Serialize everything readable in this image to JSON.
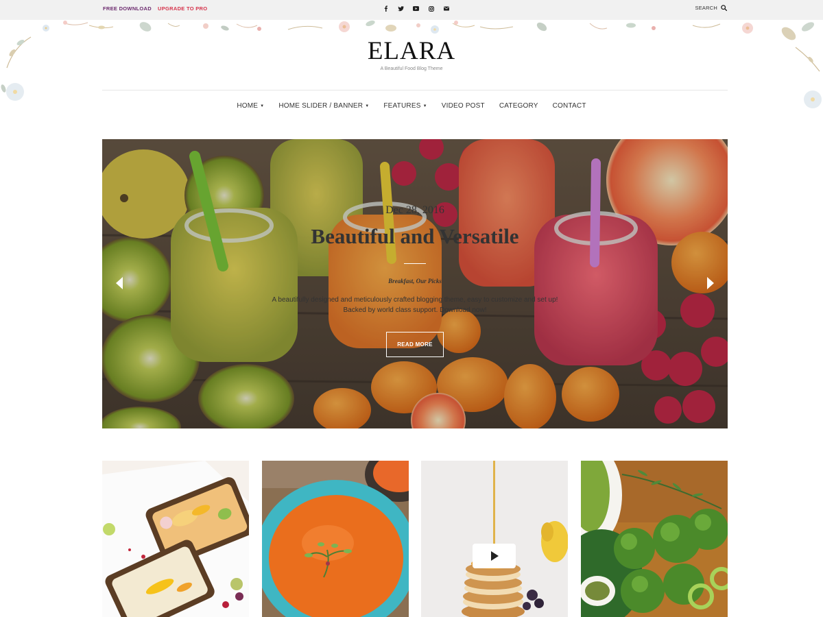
{
  "topbar": {
    "free_download": "FREE DOWNLOAD",
    "upgrade_pro": "UPGRADE TO PRO",
    "social_icons": [
      "facebook-icon",
      "twitter-icon",
      "youtube-icon",
      "instagram-icon",
      "email-icon"
    ],
    "search_label": "SEARCH"
  },
  "site": {
    "title": "ELARA",
    "tagline": "A Beautiful Food Blog Theme"
  },
  "nav": {
    "items": [
      {
        "label": "HOME",
        "has_dropdown": true
      },
      {
        "label": "HOME SLIDER / BANNER",
        "has_dropdown": true
      },
      {
        "label": "FEATURES",
        "has_dropdown": true
      },
      {
        "label": "VIDEO POST",
        "has_dropdown": false
      },
      {
        "label": "CATEGORY",
        "has_dropdown": false
      },
      {
        "label": "CONTACT",
        "has_dropdown": false
      }
    ]
  },
  "hero": {
    "date": "Dec 28, 2016",
    "title": "Beautiful and Versatile",
    "categories": "Breakfast, Our Picks",
    "description": "A beautifully designed and meticulously crafted blogging theme, easy to customize and set up! Backed by world class support. Download now!",
    "button_label": "READ MORE"
  },
  "colors": {
    "accent_free": "#6b2a6e",
    "accent_pro": "#d6334b",
    "topbar_bg": "#f1f1f1"
  },
  "cards": [
    {
      "image": "toast-with-hummus-and-peppers"
    },
    {
      "image": "orange-soup-in-blue-bowl"
    },
    {
      "image": "pancake-stack-with-syrup",
      "video": true
    },
    {
      "image": "broccoli-and-herbs"
    }
  ]
}
